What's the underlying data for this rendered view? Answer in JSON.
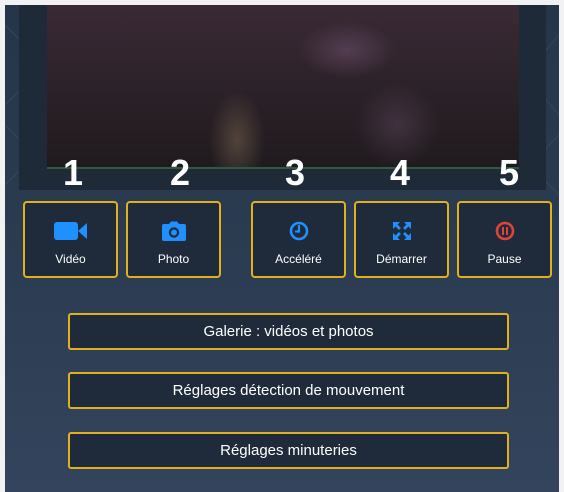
{
  "colors": {
    "accent_border": "#e1b021",
    "icon_blue": "#1e90ff",
    "pause_red": "#e0433a",
    "panel_bg": "#26364a"
  },
  "preview": {
    "numbers": [
      "1",
      "2",
      "3",
      "4",
      "5"
    ]
  },
  "controls": [
    {
      "label": "Vidéo",
      "icon": "video-camera-icon"
    },
    {
      "label": "Photo",
      "icon": "camera-icon"
    },
    {
      "label": "Accéléré",
      "icon": "clock-icon"
    },
    {
      "label": "Démarrer",
      "icon": "expand-arrows-icon"
    },
    {
      "label": "Pause",
      "icon": "pause-circle-icon"
    }
  ],
  "menu": {
    "gallery_label": "Galerie : vidéos et photos",
    "motion_label": "Réglages détection de mouvement",
    "timers_label": "Réglages minuteries"
  }
}
